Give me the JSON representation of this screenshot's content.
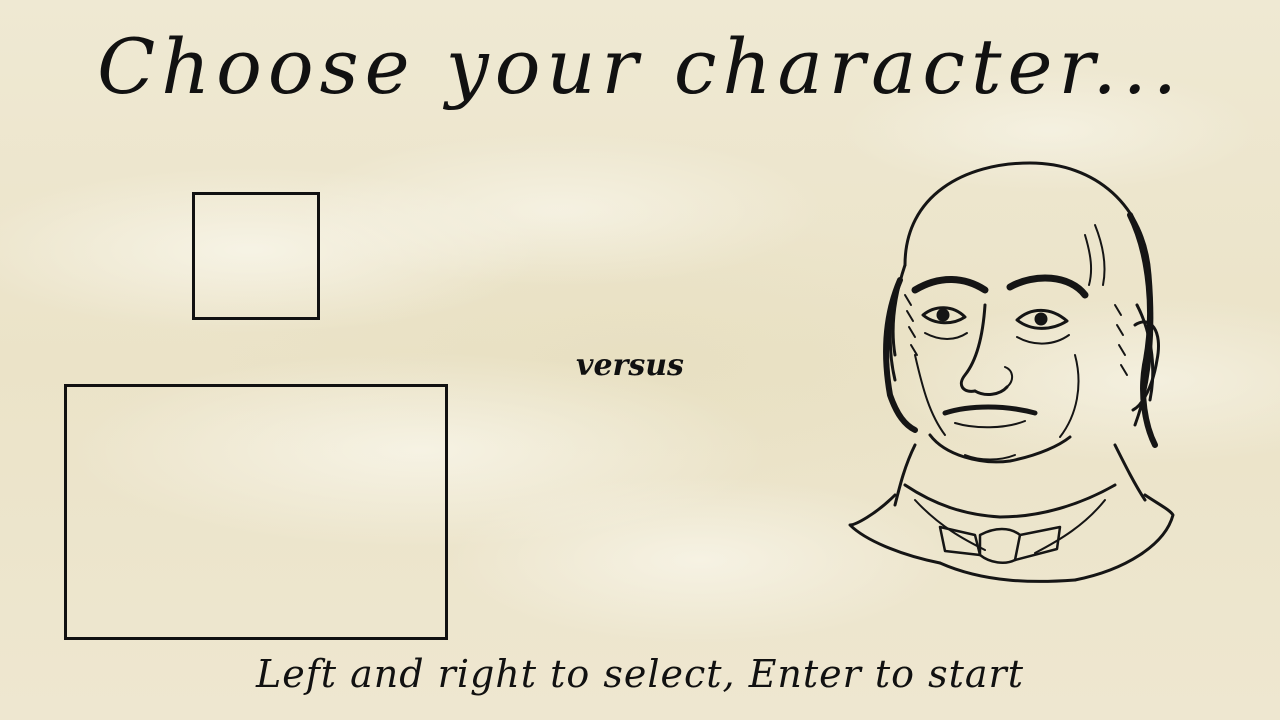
{
  "screen": {
    "title": "Choose your character...",
    "versus_label": "versus",
    "hint": "Left and right to select, Enter to start"
  },
  "player_slots": {
    "selected_portrait_slot": "",
    "character_preview_slot": ""
  },
  "opponent": {
    "portrait_icon": "engraved-portrait-bald-gentleman-icon"
  },
  "colors": {
    "background": "#ede6cf",
    "ink": "#111111"
  }
}
